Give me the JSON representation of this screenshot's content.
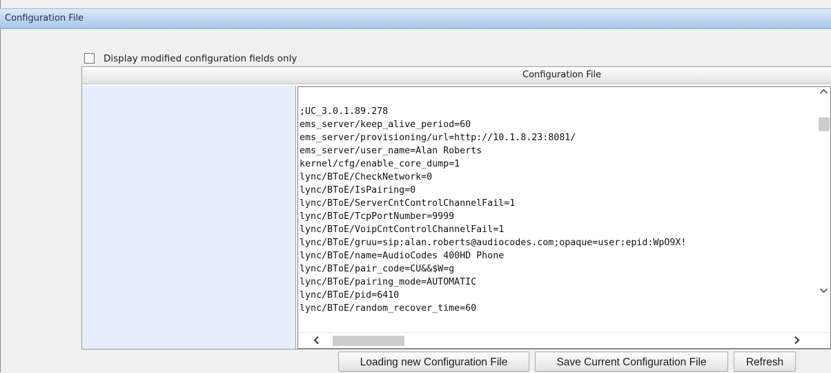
{
  "window": {
    "title": "Configuration File"
  },
  "filter": {
    "checkbox_label": "Display modified configuration fields only",
    "checked": false
  },
  "table": {
    "header": "Configuration File"
  },
  "config_lines": [
    ";UC_3.0.1.89.278",
    "ems_server/keep_alive_period=60",
    "ems_server/provisioning/url=http://10.1.8.23:8081/",
    "ems_server/user_name=Alan Roberts",
    "kernel/cfg/enable_core_dump=1",
    "lync/BToE/CheckNetwork=0",
    "lync/BToE/IsPairing=0",
    "lync/BToE/ServerCntControlChannelFail=1",
    "lync/BToE/TcpPortNumber=9999",
    "lync/BToE/VoipCntControlChannelFail=1",
    "lync/BToE/gruu=sip:alan.roberts@audiocodes.com;opaque=user:epid:WpO9X!",
    "lync/BToE/name=AudioCodes 400HD Phone",
    "lync/BToE/pair_code=CU&&$W=g",
    "lync/BToE/pairing_mode=AUTOMATIC",
    "lync/BToE/pid=6410",
    "lync/BToE/random_recover_time=60"
  ],
  "buttons": {
    "load": "Loading new Configuration File",
    "save": "Save Current Configuration File",
    "refresh": "Refresh"
  },
  "icons": {
    "scroll_up": "chevron-up-icon",
    "scroll_down": "chevron-down-icon",
    "scroll_left": "chevron-left-icon",
    "scroll_right": "chevron-right-icon"
  },
  "colors": {
    "title_bar": "#b8d0ee",
    "left_panel": "#e6eefb",
    "background": "#f0f0f0"
  }
}
